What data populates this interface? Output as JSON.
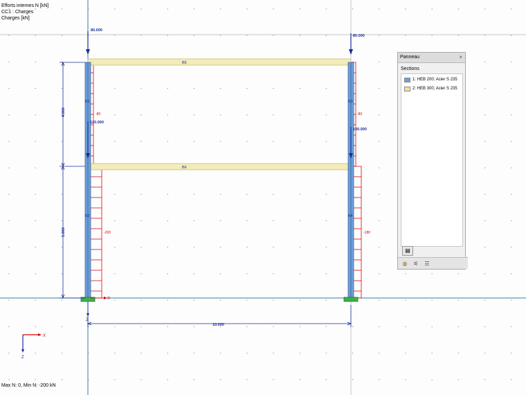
{
  "info": {
    "line1": "Efforts internes N [kN]",
    "line2": "CC1 : Charges",
    "line3": "Charges [kN]"
  },
  "status": "Max N: 0, Min N: -200 kN",
  "loads": {
    "top_left": "80.000",
    "top_right": "80.000",
    "mid_left": "120.000",
    "mid_right": "100.000"
  },
  "members": {
    "b1": "B1",
    "b2": "B2",
    "b3": "B3",
    "b4": "B4",
    "b5": "B5",
    "b6": "B6"
  },
  "results": {
    "b1": "-80",
    "b3": "-80",
    "b2": "-200",
    "b4": "-180"
  },
  "dims": {
    "upper": "4.000",
    "lower": "5.000",
    "width": "10.000"
  },
  "axes": {
    "x": "X",
    "z": "Z"
  },
  "panel": {
    "title": "Panneau",
    "close": "×",
    "sections_label": "Sections",
    "items": [
      {
        "label": "1: HEB 200; Acier S 235",
        "color": "#6e9fd8"
      },
      {
        "label": "2: HEB 300; Acier S 235",
        "color": "#ede3a6"
      }
    ]
  },
  "colors": {
    "column": "#6e9fd8",
    "beam": "#f3ecb9",
    "result": "#e00000",
    "load": "#1a2e9a",
    "axis_line": "#2f7fa6",
    "support": "#3cb04a"
  }
}
